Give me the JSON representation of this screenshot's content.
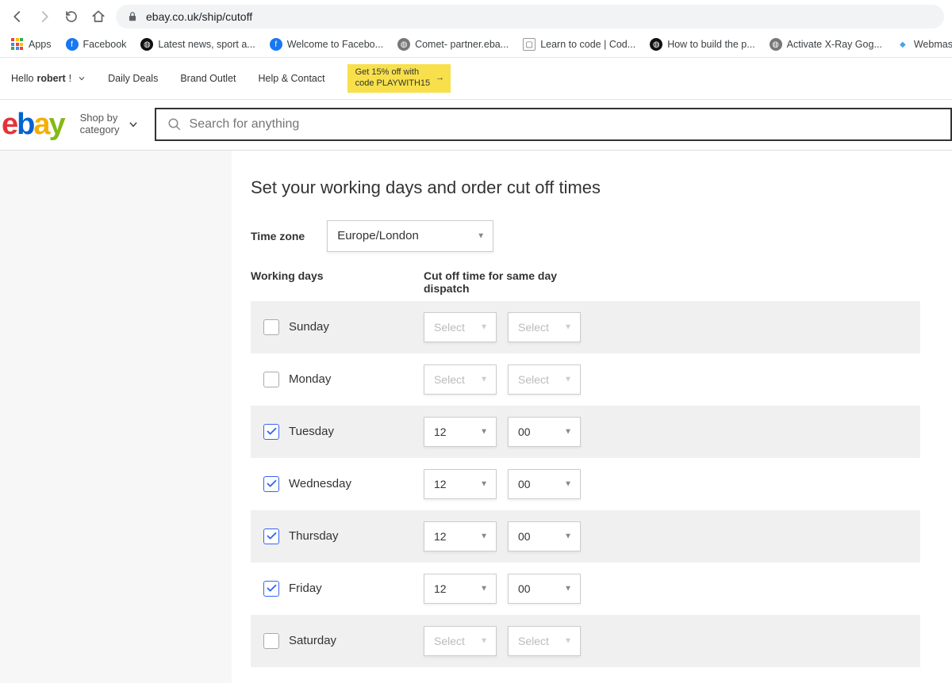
{
  "browser": {
    "url": "ebay.co.uk/ship/cutoff",
    "bookmarks": [
      {
        "label": "Apps",
        "icon": "apps"
      },
      {
        "label": "Facebook",
        "icon": "fb"
      },
      {
        "label": "Latest news, sport a...",
        "icon": "globe-dark"
      },
      {
        "label": "Welcome to Facebo...",
        "icon": "fb"
      },
      {
        "label": "Comet- partner.eba...",
        "icon": "globe"
      },
      {
        "label": "Learn to code | Cod...",
        "icon": "box"
      },
      {
        "label": "How to build the p...",
        "icon": "globe-dark"
      },
      {
        "label": "Activate X-Ray Gog...",
        "icon": "globe"
      },
      {
        "label": "Webmas",
        "icon": "diamond"
      }
    ]
  },
  "topnav": {
    "greeting_prefix": "Hello ",
    "greeting_name": "robert",
    "links": [
      "Daily Deals",
      "Brand Outlet",
      "Help & Contact"
    ],
    "promo_line1": "Get 15% off with",
    "promo_line2": "code PLAYWITH15"
  },
  "header": {
    "shop_by_l1": "Shop by",
    "shop_by_l2": "category",
    "search_placeholder": "Search for anything"
  },
  "page": {
    "title": "Set your working days and order cut off times",
    "timezone_label": "Time zone",
    "timezone_value": "Europe/London",
    "col_working": "Working days",
    "col_cutoff": "Cut off time for same day dispatch",
    "select_placeholder": "Select",
    "days": [
      {
        "name": "Sunday",
        "checked": false,
        "shaded": true,
        "hour": "",
        "min": ""
      },
      {
        "name": "Monday",
        "checked": false,
        "shaded": false,
        "hour": "",
        "min": ""
      },
      {
        "name": "Tuesday",
        "checked": true,
        "shaded": true,
        "hour": "12",
        "min": "00"
      },
      {
        "name": "Wednesday",
        "checked": true,
        "shaded": false,
        "hour": "12",
        "min": "00"
      },
      {
        "name": "Thursday",
        "checked": true,
        "shaded": true,
        "hour": "12",
        "min": "00"
      },
      {
        "name": "Friday",
        "checked": true,
        "shaded": false,
        "hour": "12",
        "min": "00"
      },
      {
        "name": "Saturday",
        "checked": false,
        "shaded": true,
        "hour": "",
        "min": ""
      }
    ]
  }
}
